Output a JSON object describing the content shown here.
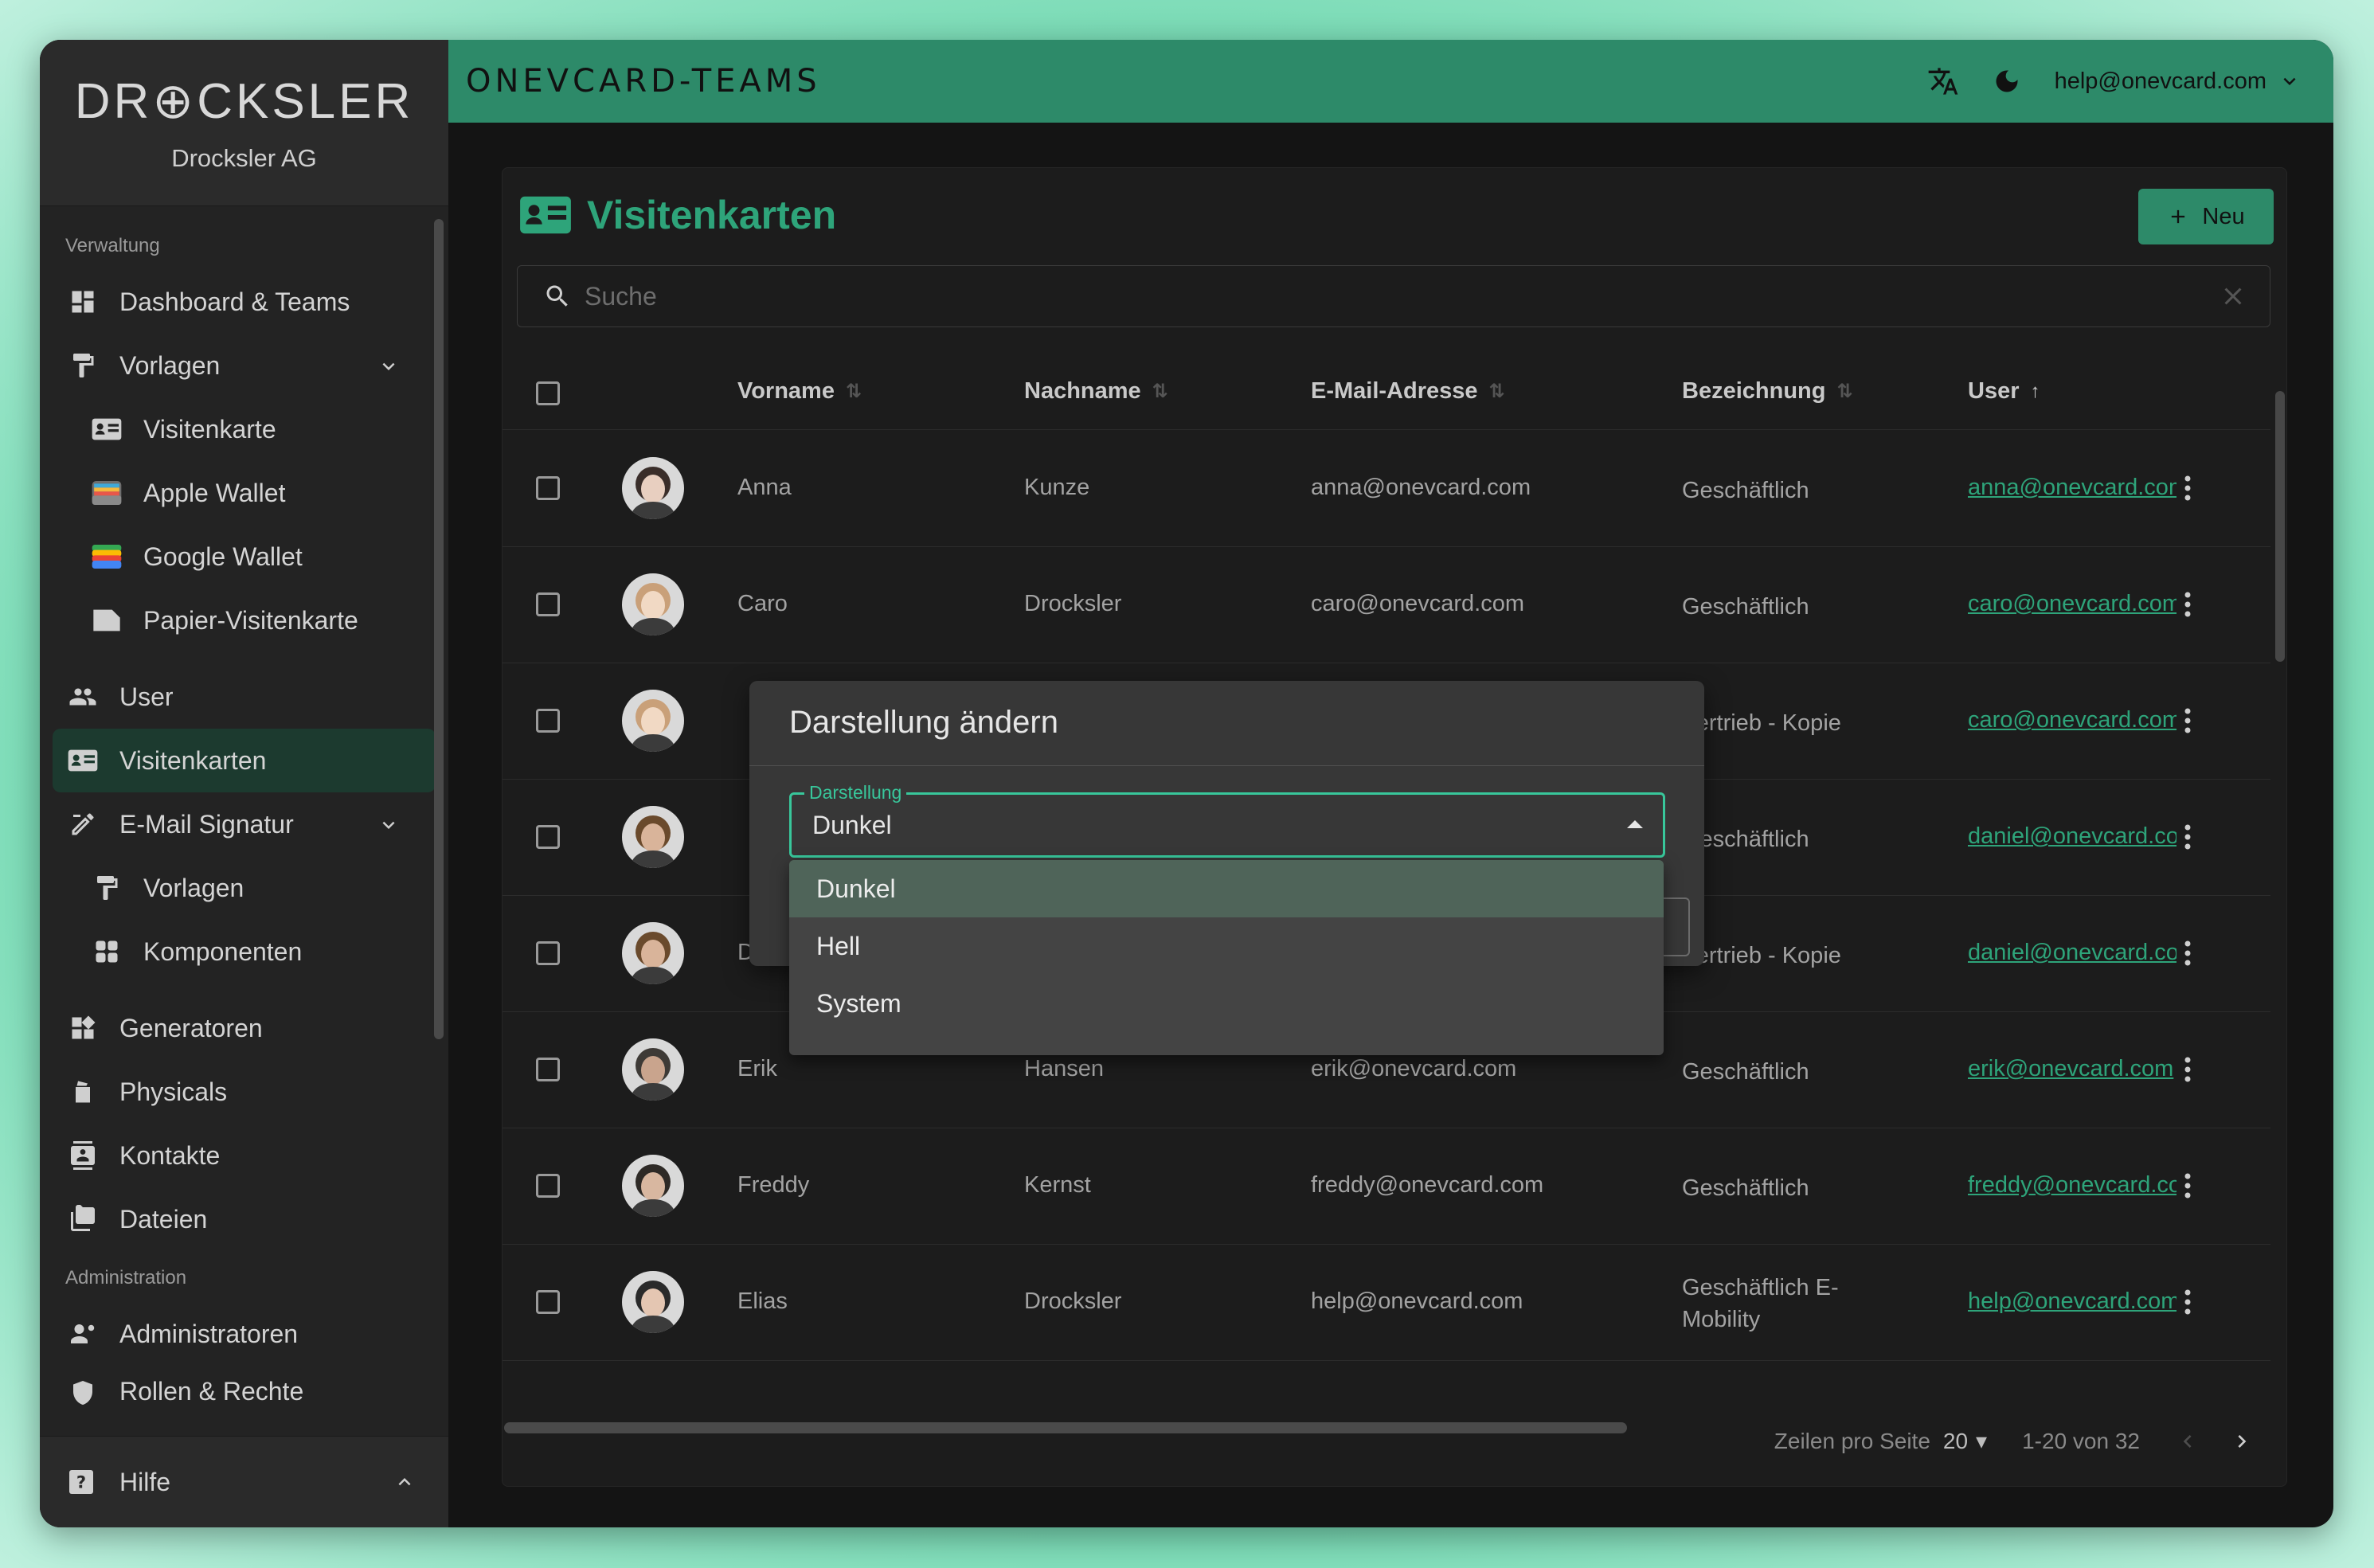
{
  "brand": {
    "logo": "DR⊕CKSLER",
    "company": "Drocksler AG"
  },
  "sidebar": {
    "section_verwaltung": "Verwaltung",
    "section_admin": "Administration",
    "items": [
      {
        "label": "Dashboard & Teams"
      },
      {
        "label": "Vorlagen"
      },
      {
        "label": "Visitenkarte"
      },
      {
        "label": "Apple Wallet"
      },
      {
        "label": "Google Wallet"
      },
      {
        "label": "Papier-Visitenkarte"
      },
      {
        "label": "User"
      },
      {
        "label": "Visitenkarten"
      },
      {
        "label": "E-Mail Signatur"
      },
      {
        "label": "Vorlagen"
      },
      {
        "label": "Komponenten"
      },
      {
        "label": "Generatoren"
      },
      {
        "label": "Physicals"
      },
      {
        "label": "Kontakte"
      },
      {
        "label": "Dateien"
      },
      {
        "label": "Administratoren"
      },
      {
        "label": "Rollen & Rechte"
      }
    ],
    "help": "Hilfe"
  },
  "topbar": {
    "app_title": "ONEVCARD-TEAMS",
    "user_email": "help@onevcard.com"
  },
  "page": {
    "title": "Visitenkarten",
    "new_button": "Neu",
    "search_placeholder": "Suche"
  },
  "table": {
    "columns": [
      "Vorname",
      "Nachname",
      "E-Mail-Adresse",
      "Bezeichnung",
      "User"
    ],
    "rows": [
      {
        "first": "Anna",
        "last": "Kunze",
        "email": "anna@onevcard.com",
        "label": "Geschäftlich",
        "user": "anna@onevcard.com"
      },
      {
        "first": "Caro",
        "last": "Drocksler",
        "email": "caro@onevcard.com",
        "label": "Geschäftlich",
        "user": "caro@onevcard.com"
      },
      {
        "first": "",
        "last": "",
        "email": "",
        "label": "Vertrieb - Kopie",
        "user": "caro@onevcard.com"
      },
      {
        "first": "",
        "last": "",
        "email": "",
        "label": "Geschäftlich",
        "user": "daniel@onevcard.com"
      },
      {
        "first": "D",
        "last": "",
        "email": "",
        "label": "Vertrieb - Kopie",
        "user": "daniel@onevcard.com"
      },
      {
        "first": "Erik",
        "last": "Hansen",
        "email": "erik@onevcard.com",
        "label": "Geschäftlich",
        "user": "erik@onevcard.com"
      },
      {
        "first": "Freddy",
        "last": "Kernst",
        "email": "freddy@onevcard.com",
        "label": "Geschäftlich",
        "user": "freddy@onevcard.com"
      },
      {
        "first": "Elias",
        "last": "Drocksler",
        "email": "help@onevcard.com",
        "label": "Geschäftlich E-Mobility",
        "user": "help@onevcard.com"
      }
    ]
  },
  "pagination": {
    "rows_label": "Zeilen pro Seite",
    "rows_value": "20",
    "range": "1-20 von 32"
  },
  "dialog": {
    "title": "Darstellung ändern",
    "field_label": "Darstellung",
    "field_value": "Dunkel",
    "options": [
      "Dunkel",
      "Hell",
      "System"
    ]
  },
  "colors": {
    "accent": "#2d8a69",
    "accent_text": "#2ea47a",
    "focus": "#38c79b"
  }
}
